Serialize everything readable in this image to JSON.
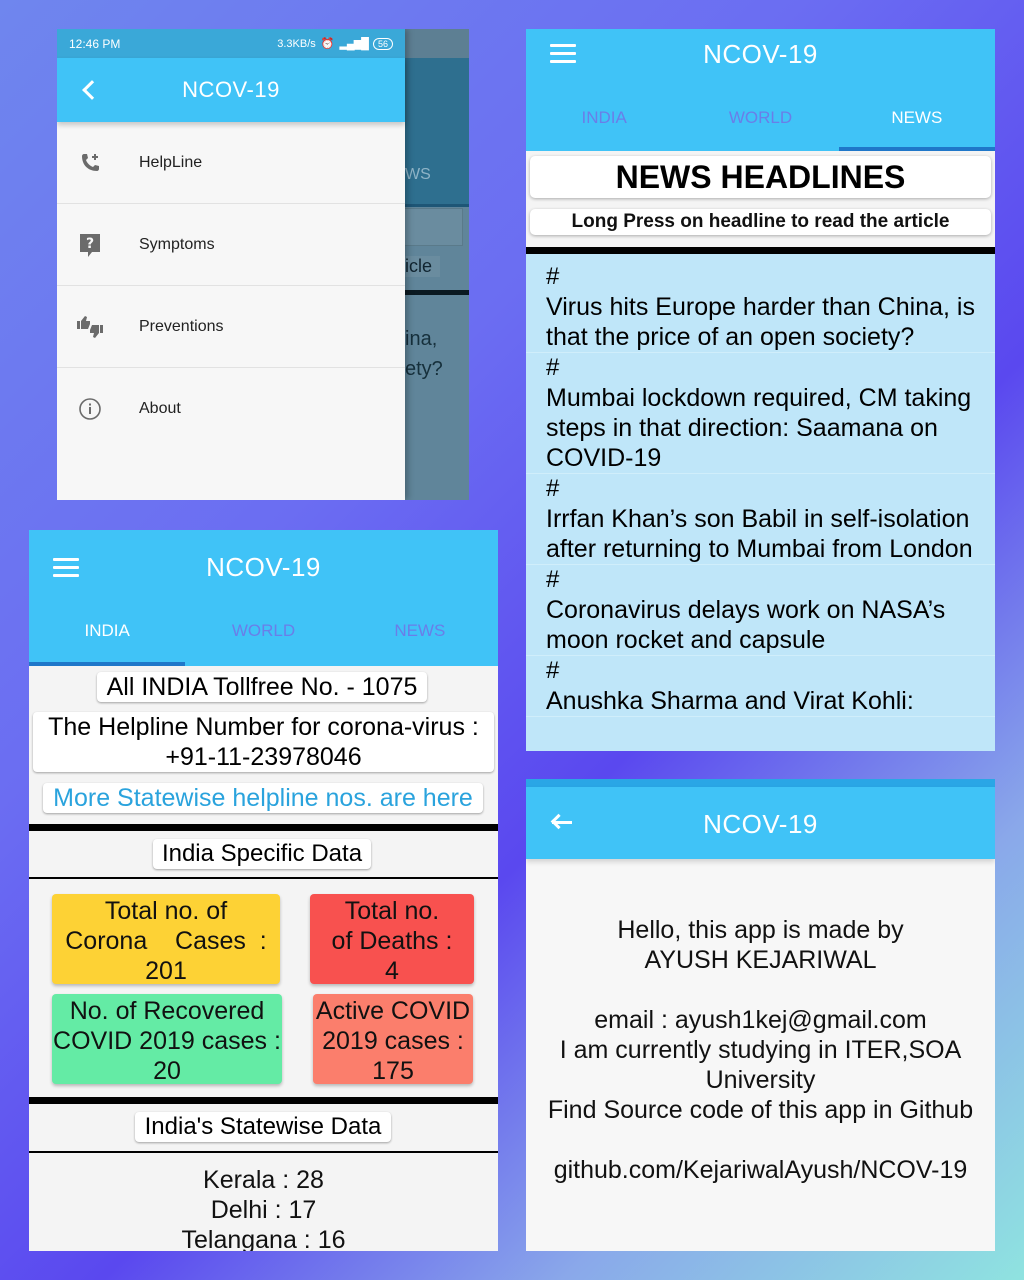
{
  "drawer_screen": {
    "status_bar": {
      "time": "12:46 PM",
      "speed": "3.3KB/s",
      "battery": "56"
    },
    "app_title": "NCOV-19",
    "menu_items": [
      {
        "label": "HelpLine",
        "icon": "phone-add-icon"
      },
      {
        "label": "Symptoms",
        "icon": "question-icon"
      },
      {
        "label": "Preventions",
        "icon": "thumbs-up-down-icon"
      },
      {
        "label": "About",
        "icon": "info-icon"
      }
    ],
    "behind_fragments": [
      "WS",
      "icle",
      "ina,",
      "ety?"
    ]
  },
  "news_screen": {
    "app_title": "NCOV-19",
    "tabs": [
      "INDIA",
      "WORLD",
      "NEWS"
    ],
    "heading": "NEWS HEADLINES",
    "subheading": "Long Press on headline to read the article",
    "headlines": [
      "Virus hits Europe harder than China, is that the price of an open society?",
      "Mumbai lockdown required, CM taking steps in that direction: Saamana on COVID-19",
      "Irrfan Khan’s son Babil in self-isolation after returning to Mumbai from London",
      "Coronavirus delays work on NASA’s moon rocket and capsule",
      "Anushka Sharma and Virat Kohli:"
    ],
    "hash": "#"
  },
  "india_screen": {
    "app_title": "NCOV-19",
    "tabs": [
      "INDIA",
      "WORLD",
      "NEWS"
    ],
    "tollfree": "All INDIA Tollfree No. - 1075",
    "helpline_line1": "The Helpline Number for corona-virus :",
    "helpline_line2": "+91-11-23978046",
    "statewise_link": "More Statewise helpline nos. are here",
    "specific_heading": "India Specific Data",
    "cards": {
      "total_cases": {
        "line1": "Total no. of",
        "line2": "Corona    Cases  :",
        "value": "201",
        "color": "#fdd235"
      },
      "total_deaths": {
        "line1": "Total no.",
        "line2": "of Deaths :",
        "value": "4",
        "color": "#f8514f"
      },
      "recovered": {
        "line1": "No. of Recovered",
        "line2": "COVID 2019 cases :",
        "value": "20",
        "color": "#64eba5"
      },
      "active": {
        "line1": "Active COVID",
        "line2": "2019 cases :",
        "value": "175",
        "color": "#fb7e6c"
      }
    },
    "statewise_heading": "India's Statewise Data",
    "states": [
      "Kerala : 28",
      "Delhi : 17",
      "Telangana : 16"
    ]
  },
  "about_screen": {
    "app_title": "NCOV-19",
    "lines": [
      "Hello, this app is made by",
      "AYUSH KEJARIWAL",
      "",
      "email : ayush1kej@gmail.com",
      "I am currently studying in ITER,SOA",
      "University",
      "Find Source code of this app in Github",
      "",
      "github.com/KejariwalAyush/NCOV-19"
    ]
  },
  "colors": {
    "app_bar": "#40c3f7",
    "tab_inactive": "#6a7ee8",
    "tab_indicator": "#1f77c9",
    "news_bg": "#bfe6f9"
  }
}
